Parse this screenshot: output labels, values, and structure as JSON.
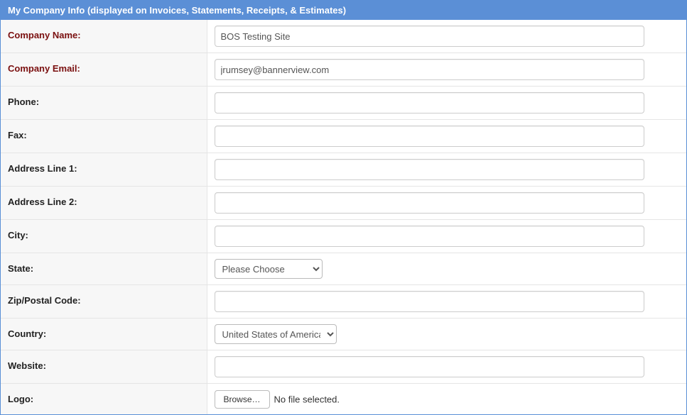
{
  "headerTitle": "My Company Info (displayed on Invoices, Statements, Receipts, & Estimates)",
  "rows": [
    {
      "id": "company-name",
      "label": "Company Name:",
      "required": true,
      "type": "text",
      "value": "BOS Testing Site"
    },
    {
      "id": "company-email",
      "label": "Company Email:",
      "required": true,
      "type": "text",
      "value": "jrumsey@bannerview.com"
    },
    {
      "id": "phone",
      "label": "Phone:",
      "required": false,
      "type": "text",
      "value": ""
    },
    {
      "id": "fax",
      "label": "Fax:",
      "required": false,
      "type": "text",
      "value": ""
    },
    {
      "id": "address-line-1",
      "label": "Address Line 1:",
      "required": false,
      "type": "text",
      "value": ""
    },
    {
      "id": "address-line-2",
      "label": "Address Line 2:",
      "required": false,
      "type": "text",
      "value": ""
    },
    {
      "id": "city",
      "label": "City:",
      "required": false,
      "type": "text",
      "value": ""
    },
    {
      "id": "state",
      "label": "State:",
      "required": false,
      "type": "select",
      "value": "Please Choose",
      "widthClass": "select-state"
    },
    {
      "id": "zip",
      "label": "Zip/Postal Code:",
      "required": false,
      "type": "text",
      "value": ""
    },
    {
      "id": "country",
      "label": "Country:",
      "required": false,
      "type": "select",
      "value": "United States of America",
      "widthClass": "select-country"
    },
    {
      "id": "website",
      "label": "Website:",
      "required": false,
      "type": "text",
      "value": ""
    },
    {
      "id": "logo",
      "label": "Logo:",
      "required": false,
      "type": "file",
      "browseLabel": "Browse…",
      "fileStatus": "No file selected."
    }
  ]
}
